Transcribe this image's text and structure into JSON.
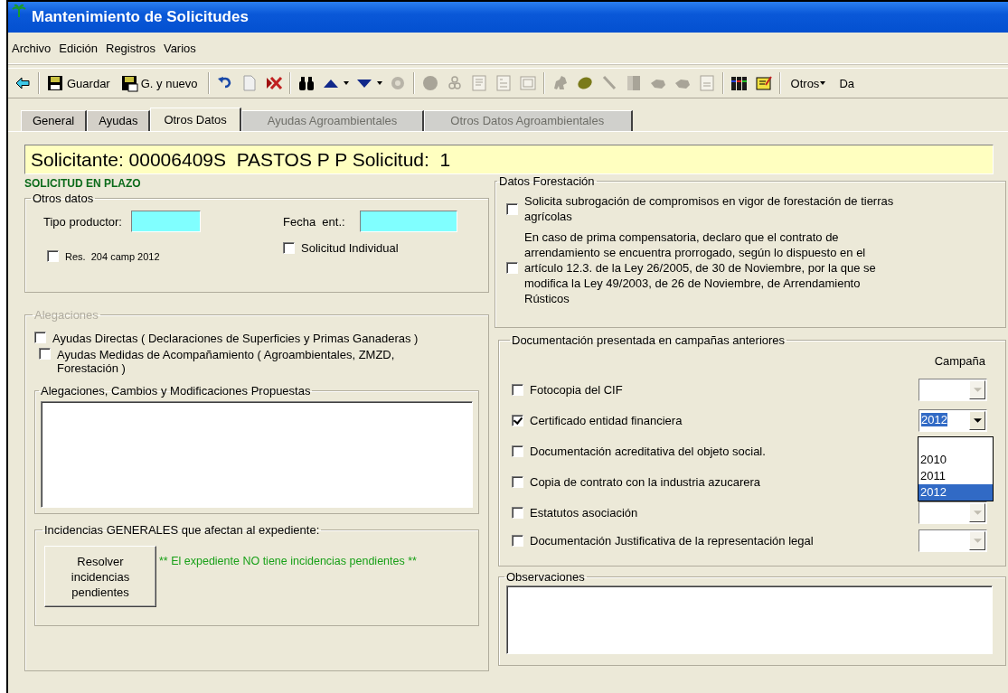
{
  "window": {
    "title": "Mantenimiento de Solicitudes"
  },
  "menu": [
    "Archivo",
    "Edición",
    "Registros",
    "Varios"
  ],
  "toolbar": {
    "buttons": [
      "Guardar",
      "G. y nuevo"
    ],
    "menus": [
      "Otros",
      "Da"
    ]
  },
  "tabs": [
    {
      "label": "General",
      "selected": false,
      "disabled": false
    },
    {
      "label": "Ayudas",
      "selected": false,
      "disabled": false
    },
    {
      "label": "Otros Datos",
      "selected": true,
      "disabled": false
    },
    {
      "label": "Ayudas Agroambientales",
      "selected": false,
      "disabled": true
    },
    {
      "label": "Otros Datos Agroambientales",
      "selected": false,
      "disabled": true
    }
  ],
  "header": {
    "applicant": "Solicitante: 00006409S  PASTOS P P Solicitud:  1",
    "status": "SOLICITUD EN PLAZO"
  },
  "otros_datos": {
    "title": "Otros datos",
    "tipo_productor": {
      "label": "Tipo productor:"
    },
    "fecha_ent": {
      "label": "Fecha  ent.:"
    },
    "checkboxes": [
      {
        "label": "Res.  204 camp 2012",
        "checked": false
      },
      {
        "label": "Solicitud Individual",
        "checked": false
      }
    ]
  },
  "alegaciones": {
    "title": "Alegaciones",
    "disabled": true,
    "checkboxes": [
      {
        "label": "Ayudas Directas ( Declaraciones de Superficies y Primas Ganaderas )",
        "checked": false
      },
      {
        "label": "Ayudas Medidas de Acompañamiento ( Agroambientales, ZMZD, Forestación )",
        "checked": false
      }
    ],
    "propuestas": {
      "title": "Alegaciones, Cambios y Modificaciones Propuestas"
    },
    "incidencias": {
      "title": "Incidencias GENERALES que afectan al expediente:",
      "button": "Resolver incidencias pendientes",
      "message": "** El expediente NO tiene incidencias pendientes **"
    }
  },
  "datos_forestacion": {
    "title": "Datos Forestación",
    "checkboxes": [
      {
        "label": "Solicita subrogación de compromisos en vigor de forestación de tierras agrícolas",
        "checked": false
      },
      {
        "label": "En caso de prima compensatoria, declaro que el contrato de arrendamiento se encuentra prorrogado, según lo dispuesto en el artículo 12.3. de la Ley 26/2005, de 30 de Noviembre, por la que se modifica la Ley 49/2003, de 26 de Noviembre, de Arrendamiento Rústicos",
        "checked": false
      }
    ]
  },
  "documentacion": {
    "title": "Documentación presentada en campañas anteriores",
    "campaign_header": "Campaña",
    "rows": [
      {
        "label": "Fotocopia del CIF",
        "checked": false,
        "campaign": {
          "disabled": true
        }
      },
      {
        "label": "Certificado entidad financiera",
        "checked": true,
        "campaign": {
          "value": "2012",
          "disabled": false,
          "focused": true,
          "open": true,
          "options": [
            {
              "label": "2010",
              "selected": false
            },
            {
              "label": "2011",
              "selected": false
            },
            {
              "label": "2012",
              "selected": true
            }
          ]
        }
      },
      {
        "label": "Documentación acreditativa del objeto social.",
        "checked": false
      },
      {
        "label": "Copia de contrato con la industria azucarera",
        "checked": false
      },
      {
        "label": "Estatutos asociación",
        "checked": false,
        "campaign": {
          "disabled": true
        }
      },
      {
        "label": "Documentación Justificativa de la representación legal",
        "checked": false,
        "campaign": {
          "disabled": true
        }
      }
    ]
  },
  "observaciones": {
    "title": "Observaciones"
  }
}
